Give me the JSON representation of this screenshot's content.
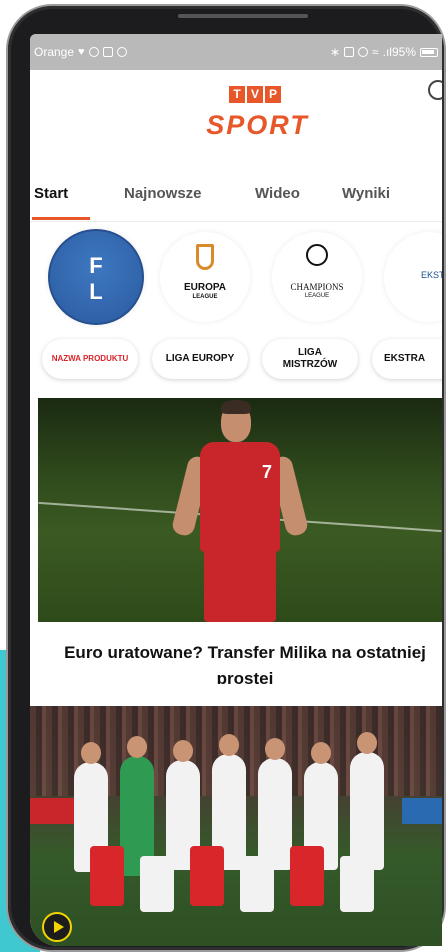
{
  "status_bar": {
    "carrier": "Orange",
    "battery": ".ıl95%"
  },
  "logo": {
    "letters": [
      "T",
      "V",
      "P"
    ],
    "wordmark": "SPORT"
  },
  "tabs": [
    {
      "label": "Start",
      "active": true
    },
    {
      "label": "Najnowsze",
      "active": false
    },
    {
      "label": "Wideo",
      "active": false
    },
    {
      "label": "Wyniki",
      "active": false
    }
  ],
  "categories": [
    {
      "circle_text": "F\nL",
      "pill_label": "NAZWA PRODUKTU"
    },
    {
      "circle_text": "EUROPA",
      "circle_subtext": "LEAGUE",
      "pill_label": "LIGA EUROPY"
    },
    {
      "circle_text": "CHAMPIONS",
      "circle_subtext": "LEAGUE",
      "pill_label": "LIGA MISTRZÓW"
    },
    {
      "circle_text": "EKSTRA",
      "pill_label": "EKSTRA"
    }
  ],
  "article1": {
    "player_number": "7"
  },
  "article2": {
    "headline": "Euro uratowane? Transfer Milika na ostatniej prostej"
  },
  "colors": {
    "brand": "#e8572a",
    "status_bar": "#b9b9b9",
    "fl_badge": "#2f63ae",
    "pill_red": "#d8252a",
    "play_icon": "#f2d400"
  }
}
